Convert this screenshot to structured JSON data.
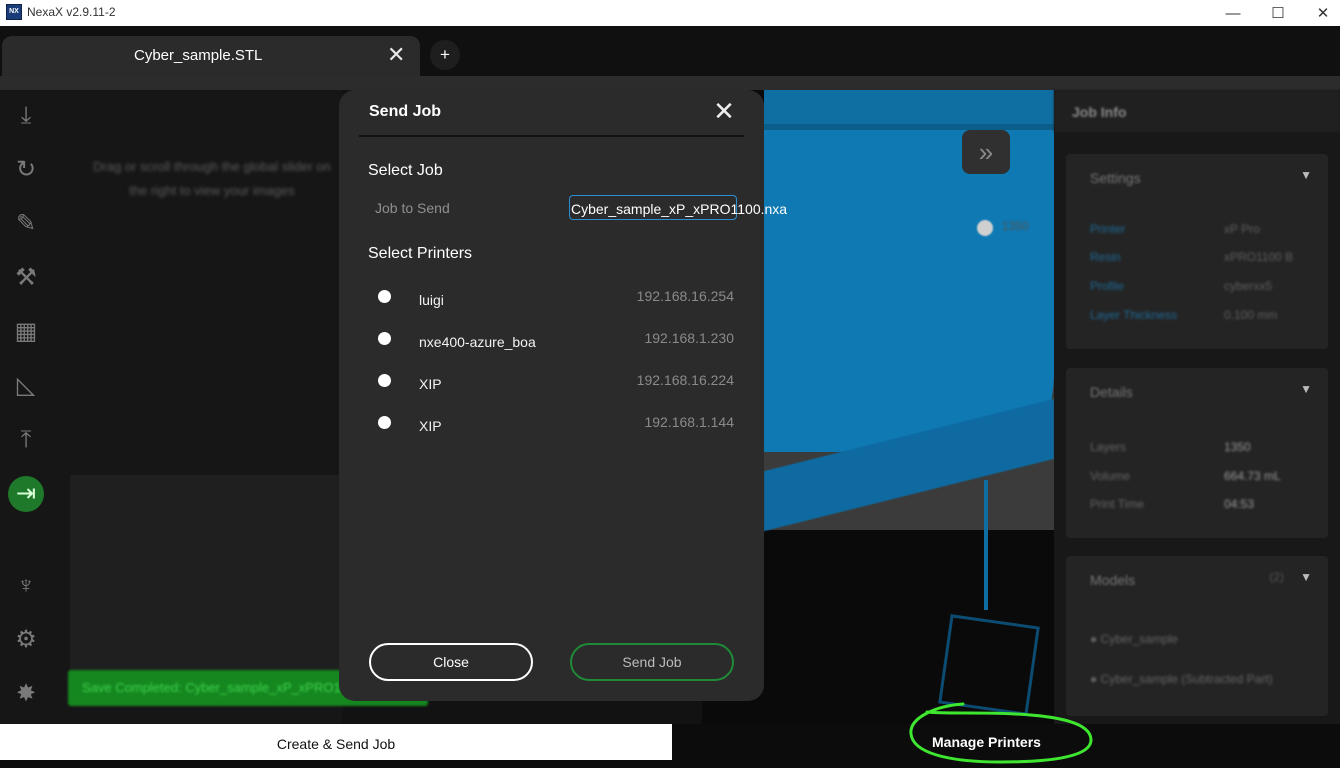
{
  "window": {
    "icon_text": "NX",
    "title": "NexaX v2.9.11-2",
    "minimize": "—",
    "maximize": "☐",
    "close": "✕"
  },
  "tabs": {
    "items": [
      {
        "label": "Cyber_sample.STL",
        "close": "✕"
      }
    ],
    "new_tab": "+"
  },
  "toolbar": {
    "icons": [
      "download-icon",
      "rotate-3d-icon",
      "label-icon",
      "tools-icon",
      "layout-grid-icon",
      "measure-icon",
      "upload-icon",
      "send-arrow-icon",
      "tooth-icon",
      "settings-gear-icon",
      "bug-icon"
    ],
    "glyphs": [
      "⤓",
      "↻",
      "✎",
      "⚒",
      "▦",
      "◺",
      "⤒",
      "⇥",
      "♆",
      "⚙",
      "✸"
    ]
  },
  "viewport": {
    "hint_text": "Drag or scroll through the global slider on the right to view your images",
    "save_banner": "Save Completed: Cyber_sample_xP_xPRO1100.nxa",
    "fast_forward": "»",
    "slider_value": "1350"
  },
  "right_panel": {
    "header": "Job Info",
    "settings": {
      "title": "Settings",
      "rows": [
        {
          "key": "Printer",
          "value": "xP Pro"
        },
        {
          "key": "Resin",
          "value": "xPRO1100 B"
        },
        {
          "key": "Profile",
          "value": "cyberxx5"
        },
        {
          "key": "Layer Thickness",
          "value": "0.100 mm"
        }
      ]
    },
    "details": {
      "title": "Details",
      "rows": [
        {
          "key": "Layers",
          "value": "1350"
        },
        {
          "key": "Volume",
          "value": "664.73 mL"
        },
        {
          "key": "Print Time",
          "value": "04:53"
        }
      ]
    },
    "models": {
      "title": "Models",
      "count": "(2)",
      "items": [
        "Cyber_sample",
        "Cyber_sample (Subtracted Part)"
      ]
    }
  },
  "dialog": {
    "title": "Send Job",
    "close_icon": "✕",
    "select_job": "Select Job",
    "job_label": "Job to Send",
    "job_value": "Cyber_sample_xP_xPRO1100.nxa",
    "select_printers": "Select Printers",
    "printers": [
      {
        "name": "luigi",
        "ip": "192.168.16.254"
      },
      {
        "name": "nxe400-azure_boa",
        "ip": "192.168.1.230"
      },
      {
        "name": "XIP",
        "ip": "192.168.16.224"
      },
      {
        "name": "XIP",
        "ip": "192.168.1.144"
      }
    ],
    "close_button": "Close",
    "send_button": "Send Job"
  },
  "bottom": {
    "left": "Create & Send Job",
    "right": "Manage Printers"
  },
  "colors": {
    "accent_green": "#1e7a2a",
    "dialog_bg": "#2b2b2b",
    "input_border": "#2a8fd0",
    "model_blue": "#0e79b3",
    "annotation_green": "#3ee62f"
  }
}
